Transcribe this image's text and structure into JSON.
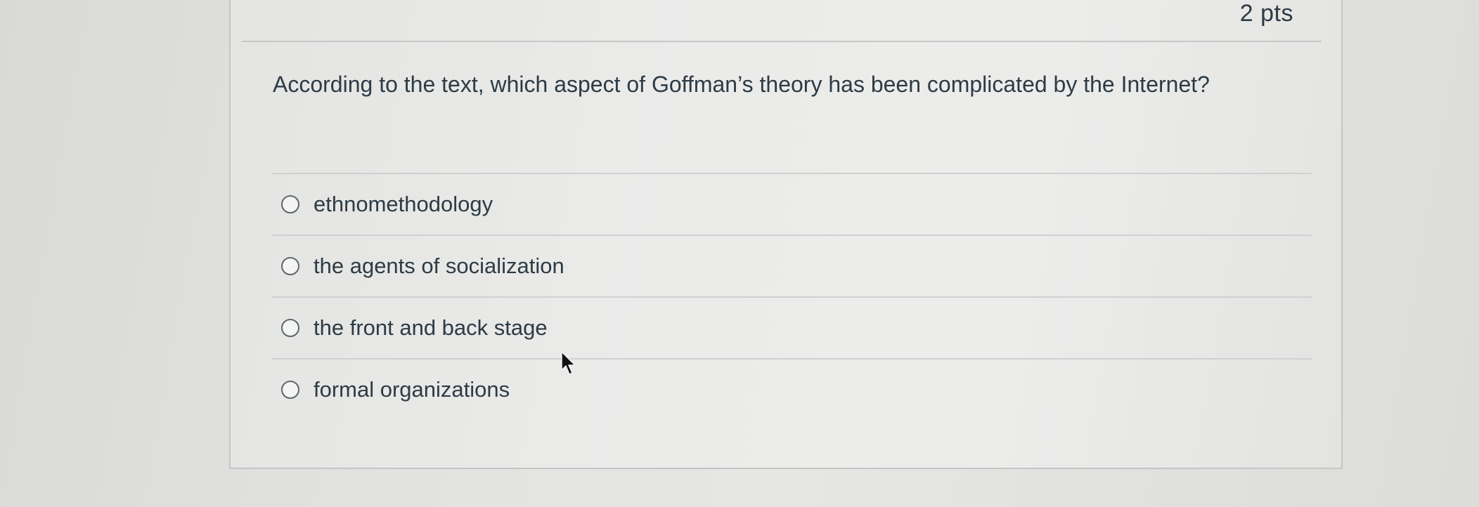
{
  "question": {
    "points": "2 pts",
    "text": "According to the text, which aspect of Goffman’s theory has been complicated by the Internet?",
    "answers": [
      {
        "label": "ethnomethodology",
        "selected": false
      },
      {
        "label": "the agents of socialization",
        "selected": false
      },
      {
        "label": "the front and back stage",
        "selected": false
      },
      {
        "label": "formal organizations",
        "selected": false
      }
    ]
  },
  "cursor": {
    "icon": "mouse-pointer-icon"
  }
}
